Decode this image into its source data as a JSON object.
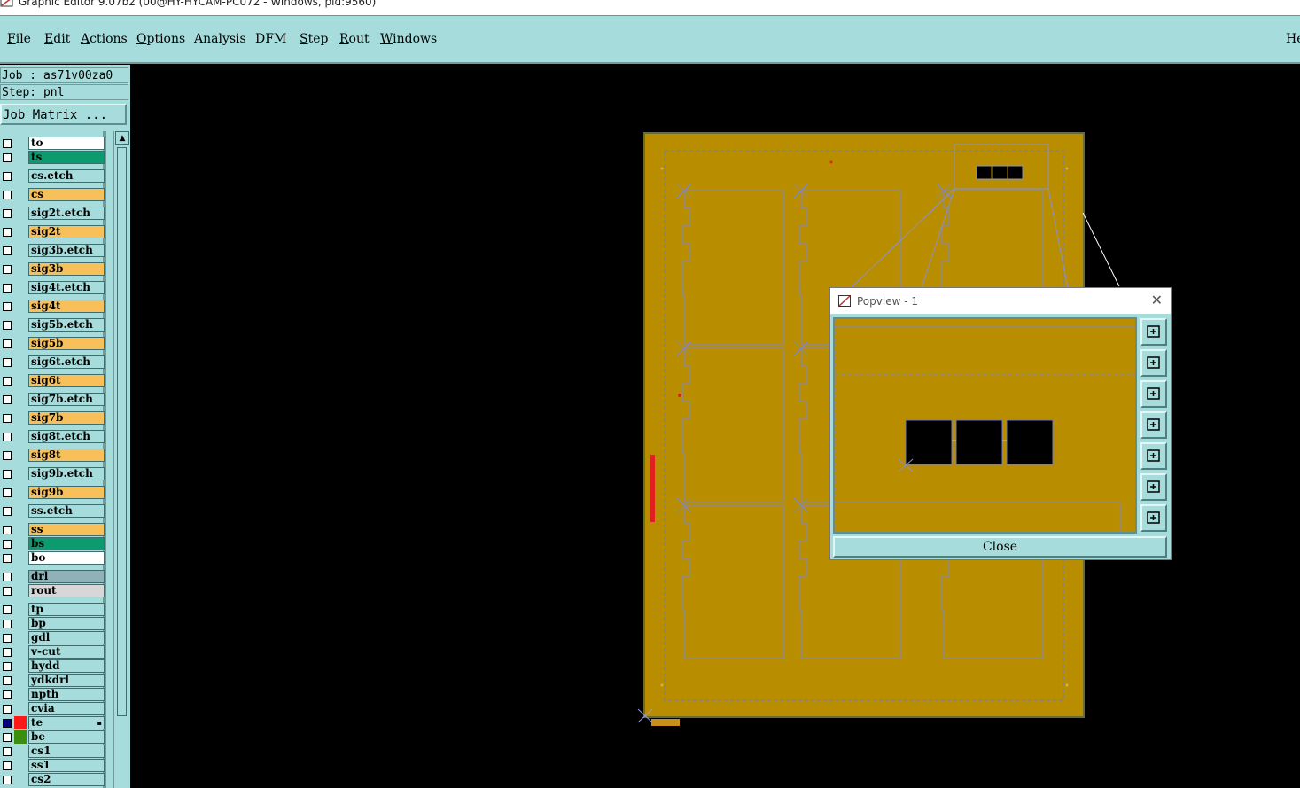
{
  "window": {
    "title": "Graphic Editor 9.07b2 (00@HY-HYCAM-PC072 - Windows, pid:9560)"
  },
  "menu": [
    {
      "label": "File",
      "underline": "F",
      "rest": "ile"
    },
    {
      "label": "Edit",
      "underline": "E",
      "rest": "dit"
    },
    {
      "label": "Actions",
      "underline": "A",
      "rest": "ctions"
    },
    {
      "label": "Options",
      "underline": "O",
      "rest": "ptions"
    },
    {
      "label": "Analysis",
      "underline": "",
      "rest": "Analysis"
    },
    {
      "label": "DFM",
      "underline": "",
      "rest": "DFM"
    },
    {
      "label": "Step",
      "underline": "S",
      "rest": "tep"
    },
    {
      "label": "Rout",
      "underline": "R",
      "rest": "out"
    },
    {
      "label": "Windows",
      "underline": "W",
      "rest": "indows"
    },
    {
      "label": "He",
      "underline": "",
      "rest": "He"
    }
  ],
  "left_panel": {
    "job": "Job : as71v00za0",
    "step": "Step: pnl",
    "job_matrix_button": "Job Matrix ..."
  },
  "layers": [
    {
      "name": "to",
      "color": "white"
    },
    {
      "name": "ts",
      "color": "green"
    },
    {
      "name": "cs.etch",
      "color": "board"
    },
    {
      "name": "cs",
      "color": "signal"
    },
    {
      "name": "sig2t.etch",
      "color": "board"
    },
    {
      "name": "sig2t",
      "color": "signal"
    },
    {
      "name": "sig3b.etch",
      "color": "board"
    },
    {
      "name": "sig3b",
      "color": "signal"
    },
    {
      "name": "sig4t.etch",
      "color": "board"
    },
    {
      "name": "sig4t",
      "color": "signal"
    },
    {
      "name": "sig5b.etch",
      "color": "board"
    },
    {
      "name": "sig5b",
      "color": "signal"
    },
    {
      "name": "sig6t.etch",
      "color": "board"
    },
    {
      "name": "sig6t",
      "color": "signal"
    },
    {
      "name": "sig7b.etch",
      "color": "board"
    },
    {
      "name": "sig7b",
      "color": "signal"
    },
    {
      "name": "sig8t.etch",
      "color": "board"
    },
    {
      "name": "sig8t",
      "color": "signal"
    },
    {
      "name": "sig9b.etch",
      "color": "board"
    },
    {
      "name": "sig9b",
      "color": "signal"
    },
    {
      "name": "ss.etch",
      "color": "board"
    },
    {
      "name": "ss",
      "color": "signal"
    },
    {
      "name": "bs",
      "color": "green"
    },
    {
      "name": "bo",
      "color": "white"
    },
    {
      "name": "drl",
      "color": "drill"
    },
    {
      "name": "rout",
      "color": "rout"
    },
    {
      "name": "tp",
      "color": "board"
    },
    {
      "name": "bp",
      "color": "board"
    },
    {
      "name": "gdl",
      "color": "board"
    },
    {
      "name": "v-cut",
      "color": "board"
    },
    {
      "name": "hydd",
      "color": "board"
    },
    {
      "name": "ydkdrl",
      "color": "board"
    },
    {
      "name": "npth",
      "color": "board"
    },
    {
      "name": "cvia",
      "color": "board"
    },
    {
      "name": "te",
      "color": "board",
      "checked": true,
      "swatch": "#ff1a1a",
      "mark": "▪"
    },
    {
      "name": "be",
      "color": "board",
      "swatch": "#3b8f10"
    },
    {
      "name": "cs1",
      "color": "board"
    },
    {
      "name": "ss1",
      "color": "board"
    },
    {
      "name": "cs2",
      "color": "board"
    }
  ],
  "popview": {
    "title": "Popview - 1",
    "close_button": "Close",
    "tools": [
      "zoom-fit-icon",
      "pan-up-icon",
      "pan-down-icon",
      "pan-left-icon",
      "pan-right-icon",
      "zoom-out-icon",
      "zoom-in-icon"
    ]
  },
  "colors": {
    "ui_background": "#a6dcdb",
    "board_fill": "#b88e00",
    "canvas": "#000000",
    "outline": "#8888cc"
  }
}
